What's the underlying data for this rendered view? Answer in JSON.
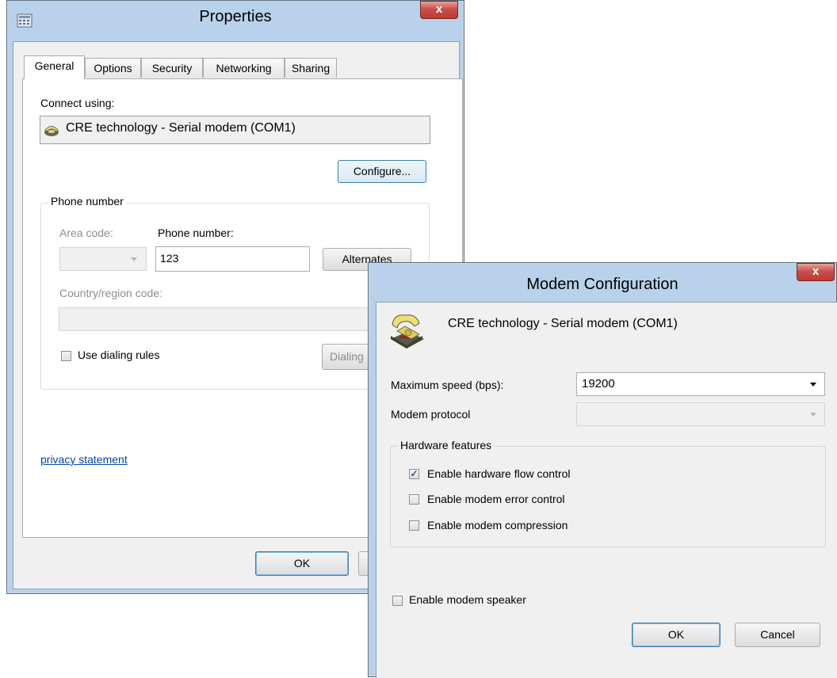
{
  "properties": {
    "title": "Properties",
    "close_glyph": "x",
    "tabs": [
      {
        "label": "General",
        "active": true
      },
      {
        "label": "Options",
        "active": false
      },
      {
        "label": "Security",
        "active": false
      },
      {
        "label": "Networking",
        "active": false
      },
      {
        "label": "Sharing",
        "active": false
      }
    ],
    "connect_using_label": "Connect using:",
    "device_name": "CRE technology - Serial modem (COM1)",
    "configure_label": "Configure...",
    "phone_group_label": "Phone number",
    "area_code_label": "Area code:",
    "phone_number_label": "Phone number:",
    "phone_number_value": "123",
    "alternates_label": "Alternates",
    "country_label": "Country/region code:",
    "use_dialing_rules_label": "Use dialing rules",
    "use_dialing_rules_checked": false,
    "dialing_label": "Dialing",
    "privacy_label": "privacy statement",
    "ok_label": "OK"
  },
  "modem": {
    "title": "Modem Configuration",
    "close_glyph": "x",
    "device_name": "CRE technology - Serial modem (COM1)",
    "max_speed_label": "Maximum speed (bps):",
    "max_speed_value": "19200",
    "protocol_label": "Modem protocol",
    "protocol_value": "",
    "hardware_group_label": "Hardware features",
    "features": [
      {
        "label": "Enable hardware flow control",
        "checked": true
      },
      {
        "label": "Enable modem error control",
        "checked": false
      },
      {
        "label": "Enable modem compression",
        "checked": false
      }
    ],
    "speaker_label": "Enable modem speaker",
    "speaker_checked": false,
    "ok_label": "OK",
    "cancel_label": "Cancel"
  },
  "colors": {
    "frame": "#b9d1ea",
    "close_red": "#c75050",
    "link": "#0645ad",
    "check": "#2b4f9c"
  },
  "icons": {
    "properties_window": "network-connection-icon",
    "device": "modem-phone-icon",
    "modem_dialog": "telephone-modem-icon"
  }
}
